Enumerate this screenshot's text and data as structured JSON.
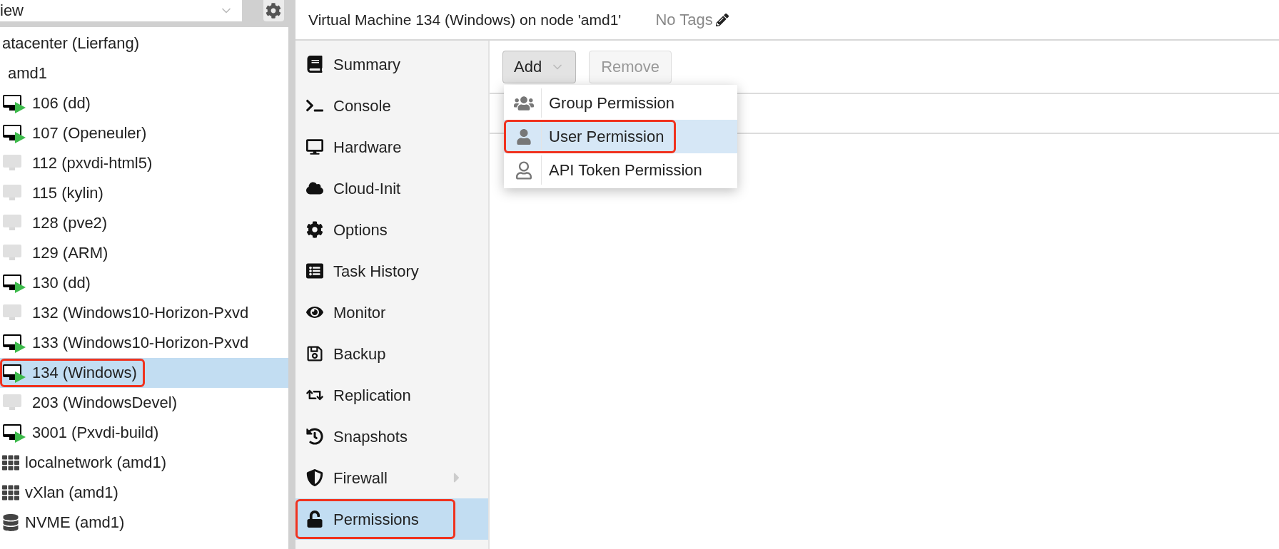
{
  "view_select": {
    "value": "iew"
  },
  "tree": [
    {
      "label": "atacenter (Lierfang)",
      "selected": false,
      "annotated": false,
      "children": [
        {
          "label": "amd1",
          "selected": false,
          "annotated": false,
          "children": [
            {
              "label": "106 (dd)",
              "kind": "vm",
              "running": true,
              "selected": false,
              "annotated": false
            },
            {
              "label": "107 (Openeuler)",
              "kind": "vm",
              "running": true,
              "selected": false,
              "annotated": false
            },
            {
              "label": "112 (pxvdi-html5)",
              "kind": "vm",
              "running": false,
              "selected": false,
              "annotated": false
            },
            {
              "label": "115 (kylin)",
              "kind": "vm",
              "running": false,
              "selected": false,
              "annotated": false
            },
            {
              "label": "128 (pve2)",
              "kind": "vm",
              "running": false,
              "selected": false,
              "annotated": false
            },
            {
              "label": "129 (ARM)",
              "kind": "vm",
              "running": false,
              "selected": false,
              "annotated": false
            },
            {
              "label": "130 (dd)",
              "kind": "vm",
              "running": true,
              "selected": false,
              "annotated": false
            },
            {
              "label": "132 (Windows10-Horizon-Pxvd",
              "kind": "vm",
              "running": false,
              "selected": false,
              "annotated": false
            },
            {
              "label": "133 (Windows10-Horizon-Pxvd",
              "kind": "vm",
              "running": true,
              "selected": false,
              "annotated": false
            },
            {
              "label": "134 (Windows)",
              "kind": "vm",
              "running": true,
              "selected": true,
              "annotated": true
            },
            {
              "label": "203 (WindowsDevel)",
              "kind": "vm",
              "running": false,
              "selected": false,
              "annotated": false
            },
            {
              "label": "3001 (Pxvdi-build)",
              "kind": "vm",
              "running": true,
              "selected": false,
              "annotated": false
            },
            {
              "label": "localnetwork (amd1)",
              "kind": "network",
              "selected": false,
              "annotated": false
            },
            {
              "label": "vXlan (amd1)",
              "kind": "network",
              "selected": false,
              "annotated": false
            },
            {
              "label": "NVME (amd1)",
              "kind": "storage",
              "selected": false,
              "annotated": false
            }
          ]
        }
      ]
    }
  ],
  "header": {
    "title": "Virtual Machine 134 (Windows) on node 'amd1'",
    "tags": "No Tags"
  },
  "nav": [
    {
      "label": "Summary",
      "kind": "summary",
      "selected": false,
      "annotated": false,
      "expandable": false
    },
    {
      "label": "Console",
      "kind": "console",
      "selected": false,
      "annotated": false,
      "expandable": false
    },
    {
      "label": "Hardware",
      "kind": "hardware",
      "selected": false,
      "annotated": false,
      "expandable": false
    },
    {
      "label": "Cloud-Init",
      "kind": "cloud",
      "selected": false,
      "annotated": false,
      "expandable": false
    },
    {
      "label": "Options",
      "kind": "options",
      "selected": false,
      "annotated": false,
      "expandable": false
    },
    {
      "label": "Task History",
      "kind": "tasks",
      "selected": false,
      "annotated": false,
      "expandable": false
    },
    {
      "label": "Monitor",
      "kind": "monitor",
      "selected": false,
      "annotated": false,
      "expandable": false
    },
    {
      "label": "Backup",
      "kind": "backup",
      "selected": false,
      "annotated": false,
      "expandable": false
    },
    {
      "label": "Replication",
      "kind": "replication",
      "selected": false,
      "annotated": false,
      "expandable": false
    },
    {
      "label": "Snapshots",
      "kind": "snapshots",
      "selected": false,
      "annotated": false,
      "expandable": false
    },
    {
      "label": "Firewall",
      "kind": "firewall",
      "selected": false,
      "annotated": false,
      "expandable": true
    },
    {
      "label": "Permissions",
      "kind": "permissions",
      "selected": true,
      "annotated": true,
      "expandable": false
    }
  ],
  "toolbar": {
    "add": {
      "label": "Add",
      "pressed": true
    },
    "remove": {
      "label": "Remove",
      "disabled": true
    }
  },
  "menu": [
    {
      "label": "Group Permission",
      "kind": "group",
      "selected": false,
      "annotated": false
    },
    {
      "label": "User Permission",
      "kind": "user",
      "selected": true,
      "annotated": true
    },
    {
      "label": "API Token Permission",
      "kind": "token",
      "selected": false,
      "annotated": false
    }
  ]
}
